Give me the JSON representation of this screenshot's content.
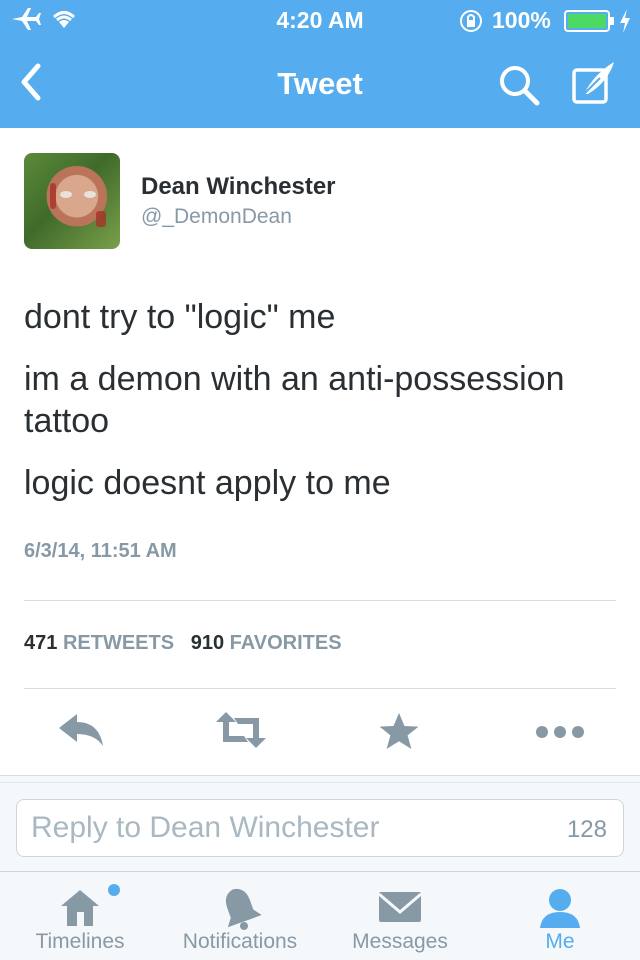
{
  "status_bar": {
    "time": "4:20 AM",
    "battery_percent": "100%",
    "icons": [
      "airplane-icon",
      "wifi-icon",
      "orientation-lock-icon",
      "battery-icon",
      "charging-bolt-icon"
    ]
  },
  "nav": {
    "title": "Tweet",
    "icons": [
      "back-chevron-icon",
      "search-icon",
      "compose-icon"
    ]
  },
  "tweet": {
    "author_name": "Dean Winchester",
    "author_handle": "@_DemonDean",
    "lines": [
      "dont try to \"logic\" me",
      "im a demon with an anti-possession tattoo",
      "logic doesnt apply to me"
    ],
    "timestamp": "6/3/14, 11:51 AM",
    "retweet_count": "471",
    "retweet_label": "RETWEETS",
    "favorite_count": "910",
    "favorite_label": "FAVORITES"
  },
  "actions": [
    "reply-icon",
    "retweet-icon",
    "favorite-star-icon",
    "more-dots-icon"
  ],
  "reply": {
    "placeholder": "Reply to Dean Winchester",
    "char_count": "128"
  },
  "tabbar": {
    "tabs": [
      {
        "label": "Timelines",
        "icon": "home-icon",
        "active": false,
        "has_unread_dot": true
      },
      {
        "label": "Notifications",
        "icon": "bell-icon",
        "active": false
      },
      {
        "label": "Messages",
        "icon": "envelope-icon",
        "active": false
      },
      {
        "label": "Me",
        "icon": "person-icon",
        "active": true
      }
    ]
  },
  "colors": {
    "brand_blue": "#55acee",
    "text_dark": "#292f33",
    "text_gray": "#8899a6",
    "action_gray": "#8899a6"
  }
}
